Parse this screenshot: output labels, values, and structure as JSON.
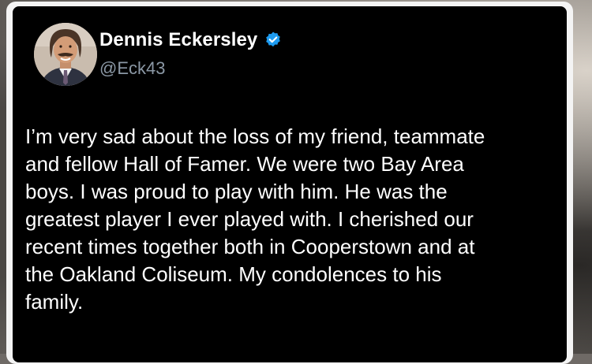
{
  "tweet": {
    "author": {
      "display_name": "Dennis Eckersley",
      "handle": "@Eck43",
      "verified": true,
      "verified_color": "#1d9bf0",
      "avatar_icon": "profile-photo"
    },
    "text": "I’m very sad about the loss of my friend, teammate\nand fellow Hall of Famer. We were two Bay Area\nboys.  I was proud to play with him. He was the\ngreatest player I ever played with. I cherished our\nrecent times together both in Cooperstown and at\nthe Oakland Coliseum. My condolences to his\nfamily."
  },
  "theme": {
    "card_background": "#000000",
    "text_color": "#ffffff",
    "handle_color": "#8b98a5"
  }
}
